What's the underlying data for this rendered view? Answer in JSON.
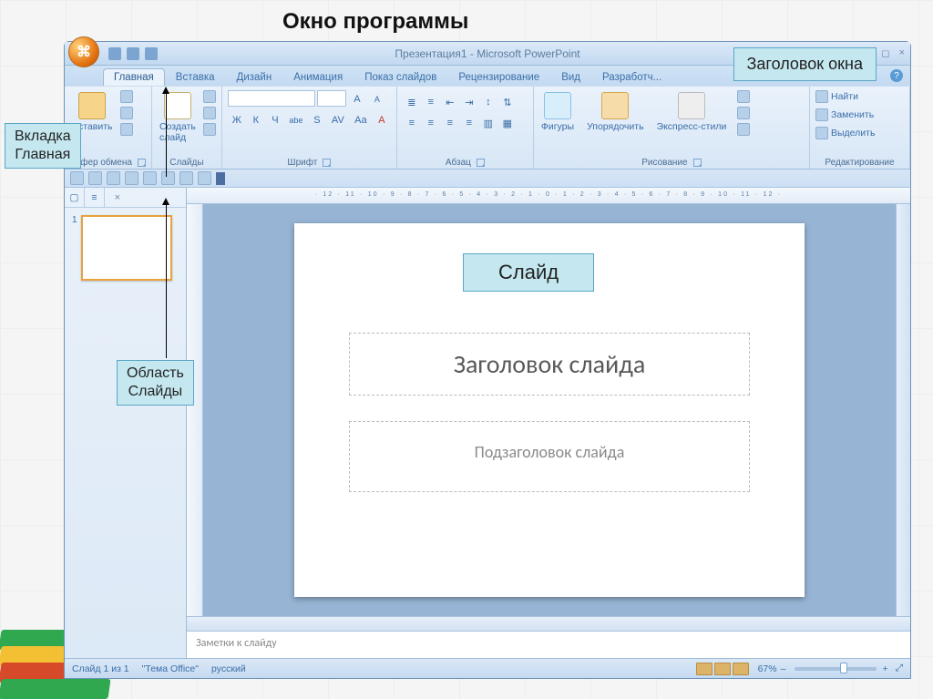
{
  "page": {
    "title": "Окно программы"
  },
  "callouts": {
    "title_bar": "Заголовок окна",
    "home_tab": "Вкладка\nГлавная",
    "slides_pane": "Область\nСлайды",
    "slide": "Слайд"
  },
  "window": {
    "title": "Презентация1 - Microsoft PowerPoint",
    "controls": {
      "minimize": "–",
      "maximize": "◻",
      "close": "×"
    },
    "help": "?"
  },
  "tabs": [
    "Главная",
    "Вставка",
    "Дизайн",
    "Анимация",
    "Показ слайдов",
    "Рецензирование",
    "Вид",
    "Разработч..."
  ],
  "active_tab_index": 0,
  "ribbon": {
    "clipboard": {
      "label": "Буфер обмена",
      "paste": "Вставить",
      "side": [
        "Вырезать",
        "Копировать",
        "Формат"
      ]
    },
    "slides": {
      "label": "Слайды",
      "new_slide": "Создать\nслайд"
    },
    "font": {
      "label": "Шрифт",
      "font_box": "",
      "size_box": "",
      "buttons": [
        "Ж",
        "К",
        "Ч",
        "abe",
        "S",
        "AV",
        "Aa",
        "A"
      ]
    },
    "paragraph": {
      "label": "Абзац"
    },
    "drawing": {
      "label": "Рисование",
      "shapes": "Фигуры",
      "arrange": "Упорядочить",
      "quick_styles": "Экспресс-стили"
    },
    "editing": {
      "label": "Редактирование",
      "find": "Найти",
      "replace": "Заменить",
      "select": "Выделить"
    }
  },
  "slide_panel": {
    "tabs_icon": "▢",
    "close": "×",
    "thumb_number": "1"
  },
  "ruler": "· 12 · 11 · 10 · 9 · 8 · 7 · 6 · 5 · 4 · 3 · 2 · 1 · 0 · 1 · 2 · 3 · 4 · 5 · 6 · 7 · 8 · 9 · 10 · 11 · 12 ·",
  "slide": {
    "title_placeholder": "Заголовок слайда",
    "subtitle_placeholder": "Подзаголовок слайда"
  },
  "notes": {
    "placeholder": "Заметки к слайду"
  },
  "status": {
    "slide_count": "Слайд 1 из 1",
    "theme": "\"Тема Office\"",
    "language": "русский",
    "zoom": "67%",
    "zoom_minus": "–",
    "zoom_plus": "+",
    "fit": "⤢"
  }
}
